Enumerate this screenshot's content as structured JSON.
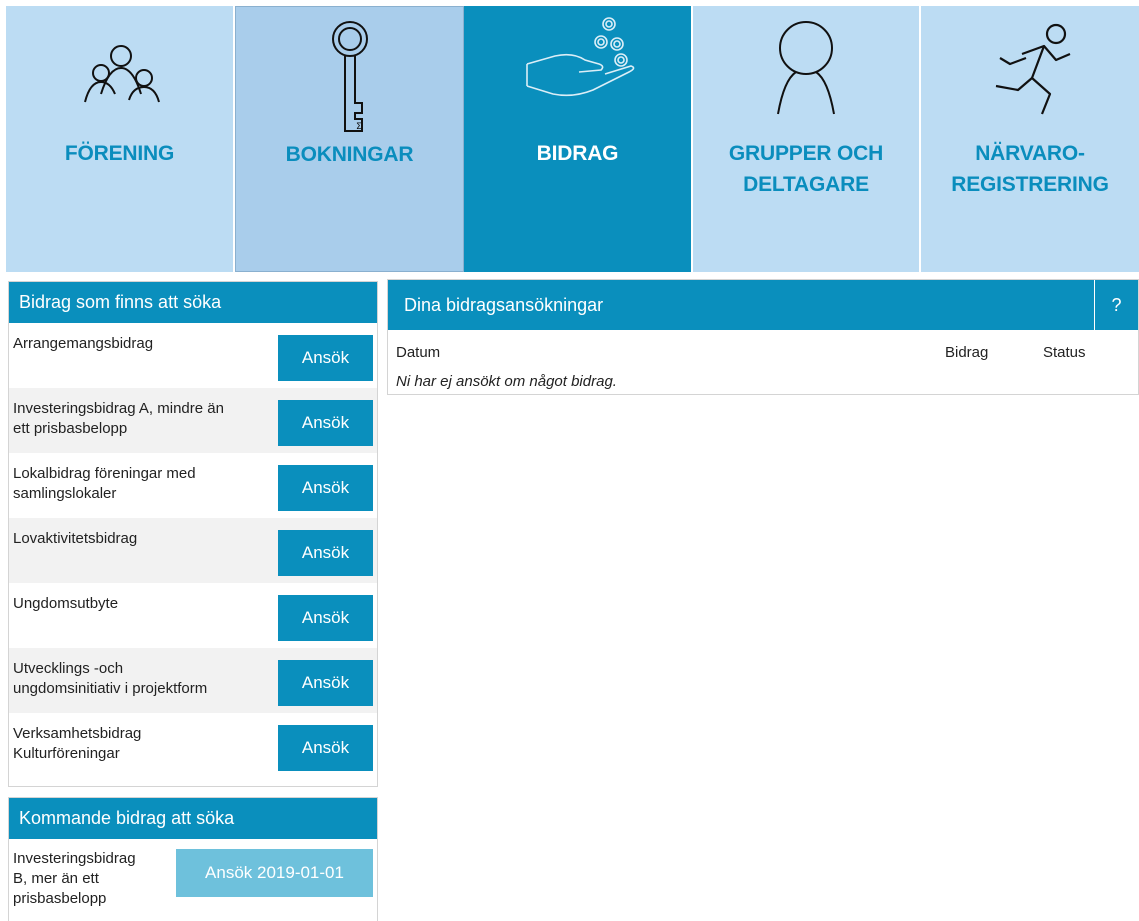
{
  "nav": {
    "forening": "FÖRENING",
    "bokningar": "BOKNINGAR",
    "bidrag": "BIDRAG",
    "grupper_line1": "GRUPPER OCH",
    "grupper_line2": "DELTAGARE",
    "narvaro_line1": "NÄRVARO-",
    "narvaro_line2": "REGISTRERING",
    "active": "bidrag"
  },
  "available": {
    "title": "Bidrag som finns att söka",
    "button_label": "Ansök",
    "items": [
      {
        "line1": "Arrangemangsbidrag",
        "line2": ""
      },
      {
        "line1": "Investeringsbidrag A, mindre än",
        "line2": "ett prisbasbelopp"
      },
      {
        "line1": "Lokalbidrag föreningar med",
        "line2": "samlingslokaler"
      },
      {
        "line1": "Lovaktivitetsbidrag",
        "line2": ""
      },
      {
        "line1": "Ungdomsutbyte",
        "line2": ""
      },
      {
        "line1": "Utvecklings -och",
        "line2": "ungdomsinitiativ i projektform"
      },
      {
        "line1": "Verksamhetsbidrag",
        "line2": "Kulturföreningar"
      }
    ]
  },
  "upcoming": {
    "title": "Kommande bidrag att söka",
    "items": [
      {
        "line1": "Investeringsbidrag",
        "line2": "B, mer än ett",
        "line3": "prisbasbelopp",
        "button": "Ansök 2019-01-01"
      }
    ]
  },
  "applications": {
    "title": "Dina bidragsansökningar",
    "help": "?",
    "col_date": "Datum",
    "col_grant": "Bidrag",
    "col_status": "Status",
    "empty": "Ni har ej ansökt om något bidrag."
  },
  "colors": {
    "primary": "#0a8fbd",
    "tile_light": "#bcdcf3",
    "tile_selected": "#a9cdeb",
    "disabled_button": "#6ec1dc"
  }
}
